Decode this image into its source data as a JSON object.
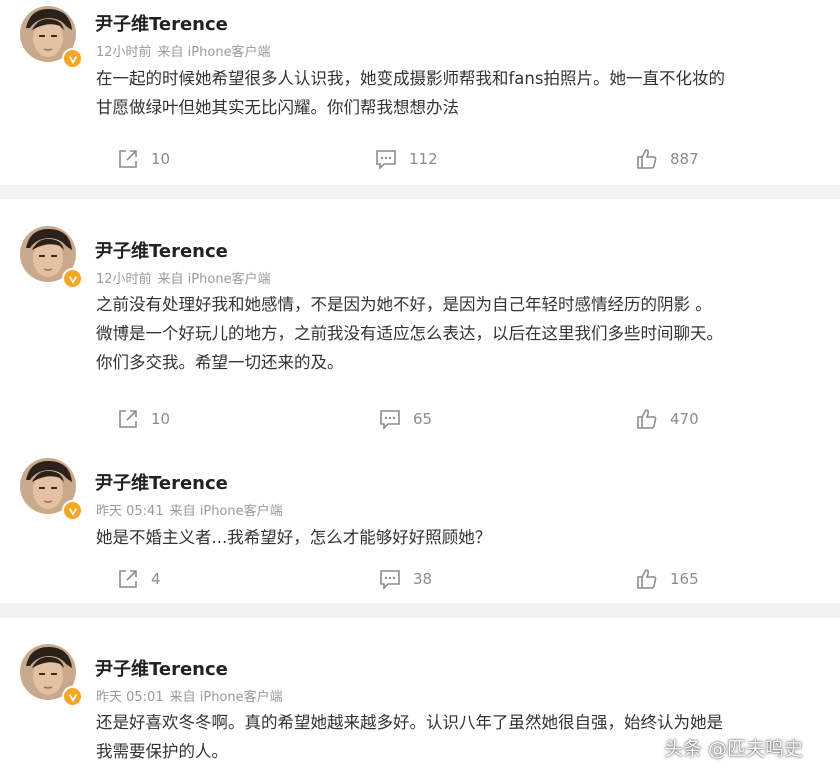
{
  "posts": [
    {
      "user": "尹子维Terence",
      "time": "12小时前",
      "source": "来自 iPhone客户端",
      "text": "在一起的时候她希望很多人认识我，她变成摄影师帮我和fans拍照片。她一直不化妆的\n甘愿做绿叶但她其实无比闪耀。你们帮我想想办法",
      "reposts": "10",
      "comments": "112",
      "likes": "887"
    },
    {
      "user": "尹子维Terence",
      "time": "12小时前",
      "source": "来自 iPhone客户端",
      "text": "之前没有处理好我和她感情，不是因为她不好，是因为自己年轻时感情经历的阴影 。\n微博是一个好玩儿的地方，之前我没有适应怎么表达，以后在这里我们多些时间聊天。\n你们多交我。希望一切还来的及。",
      "reposts": "10",
      "comments": "65",
      "likes": "470"
    },
    {
      "user": "尹子维Terence",
      "time": "昨天 05:41",
      "source": "来自 iPhone客户端",
      "text": "她是不婚主义者...我希望好，怎么才能够好好照顾她？",
      "reposts": "4",
      "comments": "38",
      "likes": "165"
    },
    {
      "user": "尹子维Terence",
      "time": "昨天 05:01",
      "source": "来自 iPhone客户端",
      "text": "还是好喜欢冬冬啊。真的希望她越来越多好。认识八年了虽然她很自强，始终认为她是\n我需要保护的人。"
    }
  ],
  "watermark": "头条 @匹夫鸣史",
  "colors": {
    "background": "#f2f2f2",
    "card": "#ffffff",
    "verified_badge": "#f5a623",
    "meta_text": "#9a9a9a",
    "action_text": "#8c8c8c"
  },
  "icons": {
    "repost": "share-box-icon",
    "comment": "comment-bubble-icon",
    "like": "thumbs-up-icon",
    "verified": "verified-v-icon"
  }
}
